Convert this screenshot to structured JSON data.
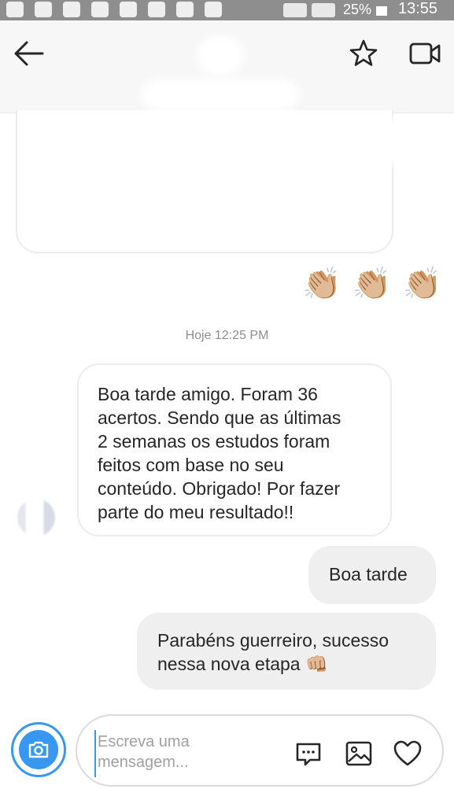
{
  "status_bar": {
    "battery": "25%",
    "time": "13:55"
  },
  "header": {
    "back_icon": "arrow-left-icon",
    "star_icon": "star-icon",
    "video_icon": "video-camera-icon"
  },
  "thread": {
    "reactions": [
      "👏🏼",
      "👏🏼",
      "👏🏼"
    ],
    "timestamp": "Hoje 12:25 PM",
    "messages": [
      {
        "direction": "incoming",
        "text": "Boa tarde amigo. Foram 36\nacertos. Sendo que as últimas\n2 semanas os estudos foram\nfeitos com base no seu\nconteúdo. Obrigado! Por fazer\nparte do meu resultado!!"
      },
      {
        "direction": "outgoing",
        "text": "Boa tarde"
      },
      {
        "direction": "outgoing",
        "text": "Parabéns guerreiro, sucesso\nnessa nova etapa 👊🏼"
      }
    ]
  },
  "composer": {
    "placeholder": "Escreva uma mensagem...",
    "camera_icon": "camera-icon",
    "sticker_icon": "chat-bubble-icon",
    "gallery_icon": "image-icon",
    "like_icon": "heart-icon",
    "accent_color": "#3897f0"
  }
}
